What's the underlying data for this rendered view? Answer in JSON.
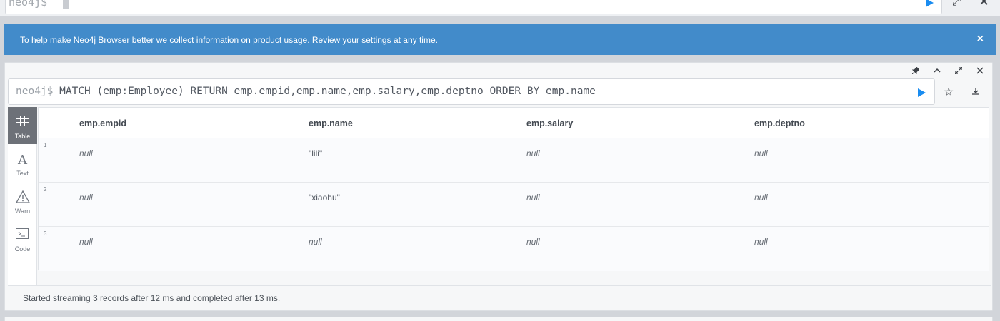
{
  "top_editor": {
    "prompt": "neo4j$"
  },
  "banner": {
    "text_before": "To help make Neo4j Browser better we collect information on product usage. Review your ",
    "link": "settings",
    "text_after": " at any time.",
    "close": "×"
  },
  "frame": {
    "query_prompt": "neo4j$",
    "query": "MATCH (emp:Employee) RETURN emp.empid,emp.name,emp.salary,emp.deptno ORDER BY emp.name",
    "tools": {
      "pin": "📌",
      "collapse": "⌃",
      "expand": "⤢",
      "close": "✕"
    },
    "nav": [
      {
        "label": "Table"
      },
      {
        "label": "Text"
      },
      {
        "label": "Warn"
      },
      {
        "label": "Code"
      }
    ],
    "table": {
      "columns": [
        "emp.empid",
        "emp.name",
        "emp.salary",
        "emp.deptno"
      ],
      "rows": [
        {
          "num": "1",
          "cells": [
            "null",
            "\"lili\"",
            "null",
            "null"
          ]
        },
        {
          "num": "2",
          "cells": [
            "null",
            "\"xiaohu\"",
            "null",
            "null"
          ]
        },
        {
          "num": "3",
          "cells": [
            "null",
            "null",
            "null",
            "null"
          ]
        }
      ]
    },
    "status": "Started streaming 3 records after 12 ms and completed after 13 ms."
  },
  "colors": {
    "banner": "#428bca",
    "run": "#1a8cf0",
    "nav_active": "#6d7178"
  }
}
